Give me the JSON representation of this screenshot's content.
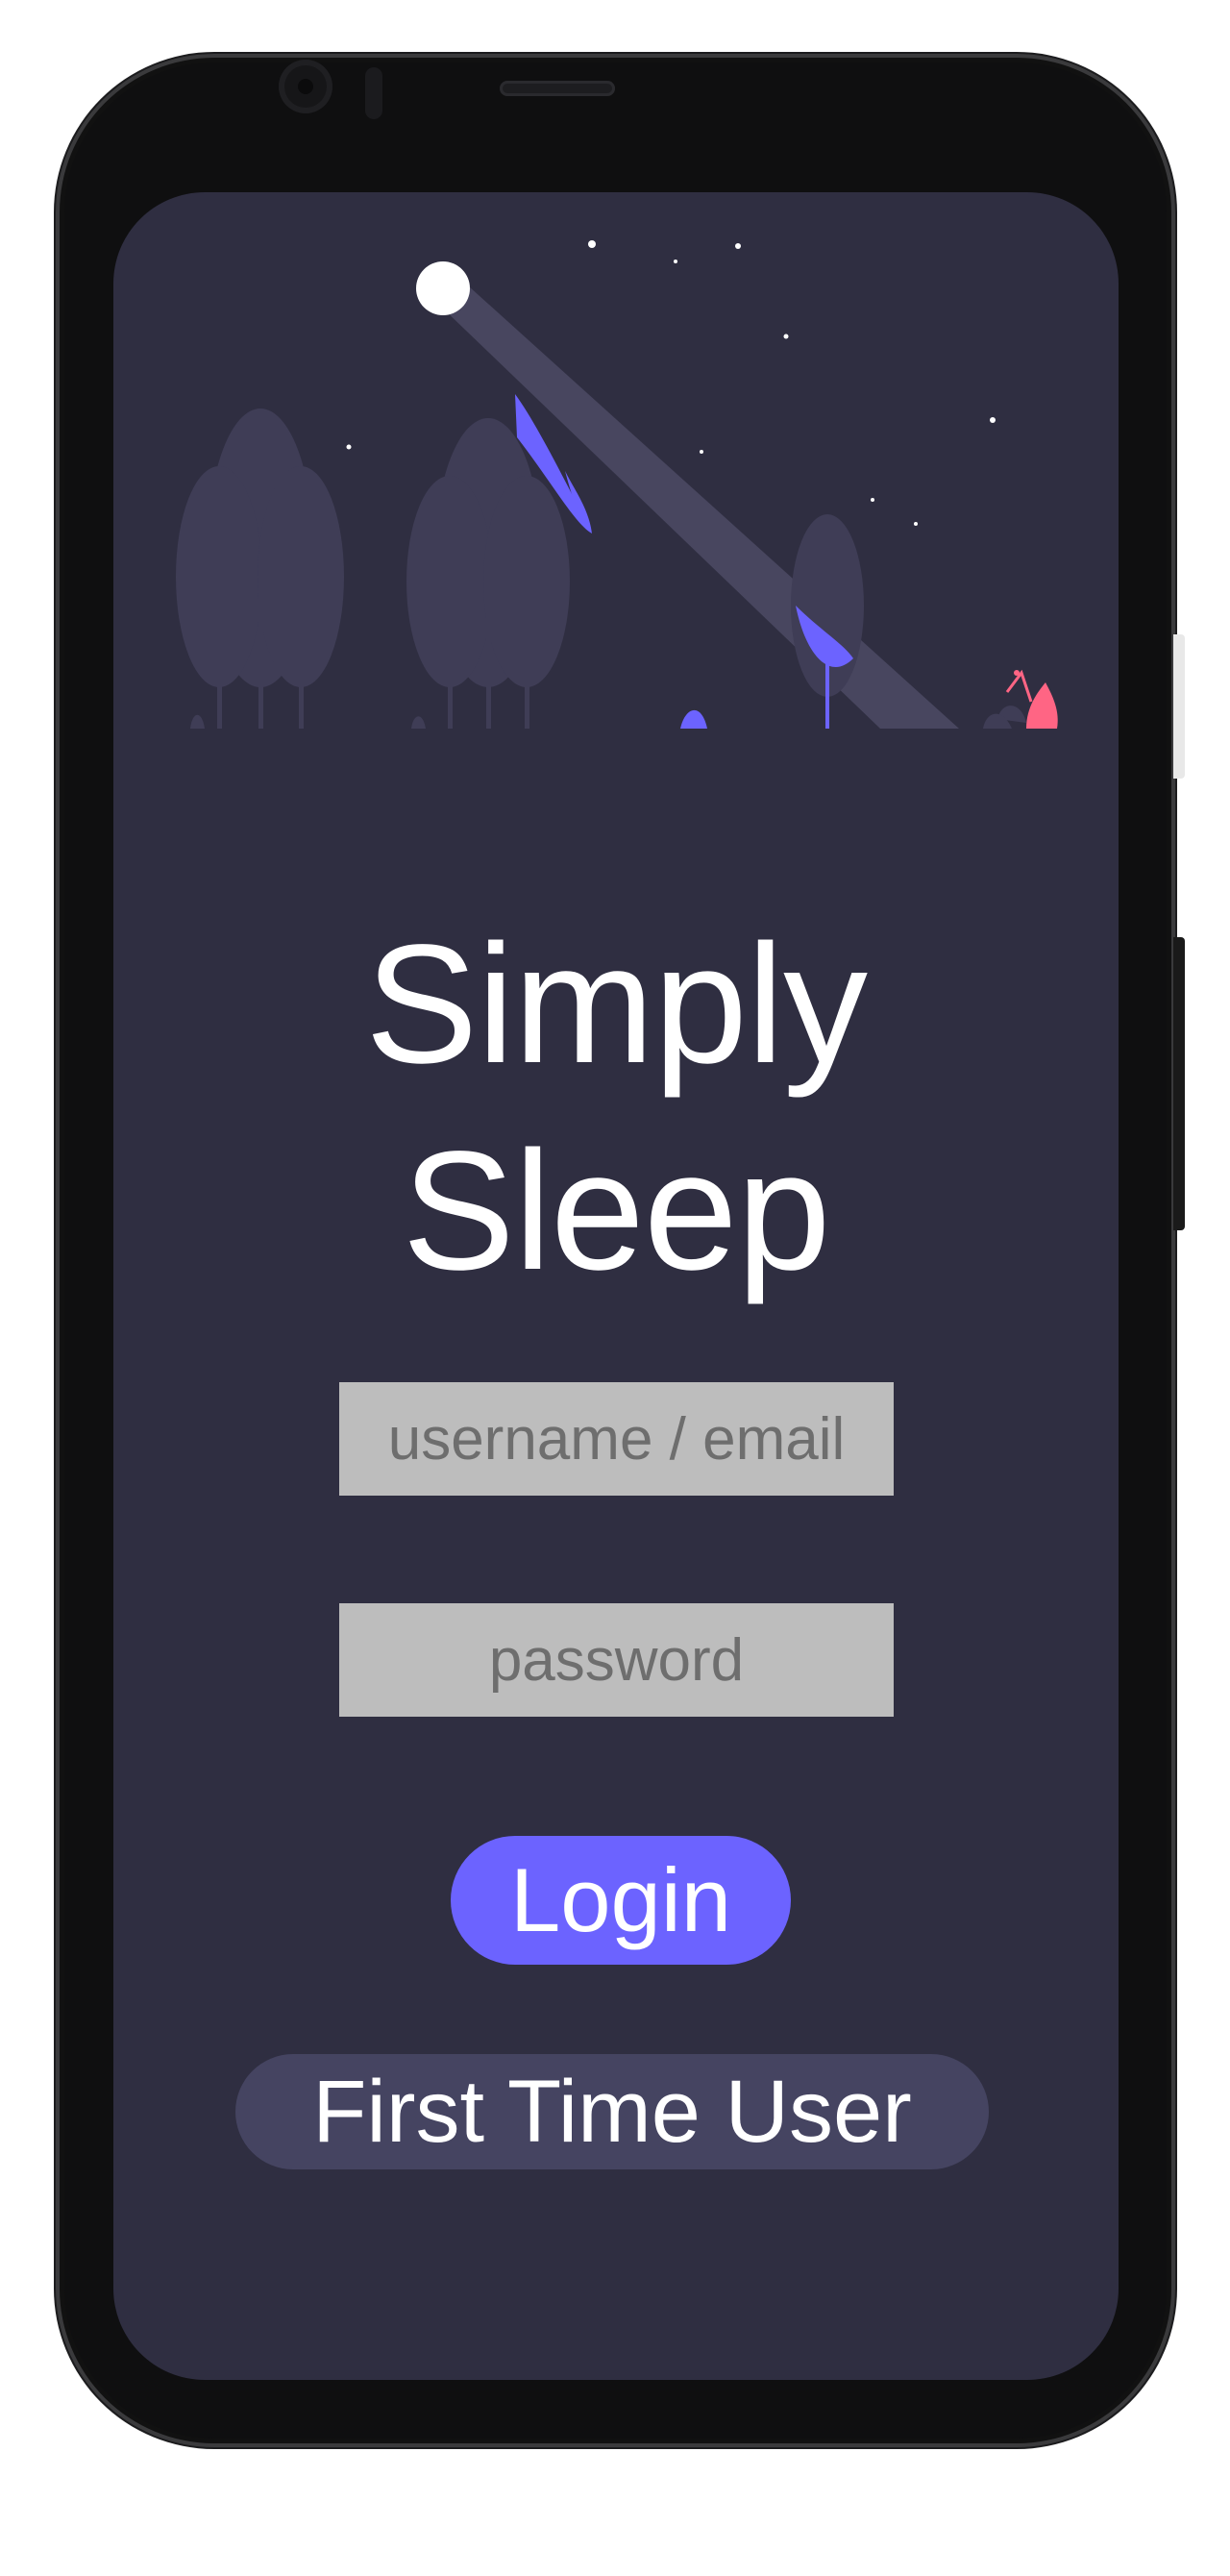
{
  "app": {
    "title_line1": "Simply",
    "title_line2": "Sleep"
  },
  "form": {
    "username_placeholder": "username / email",
    "username_value": "",
    "password_placeholder": "password",
    "password_value": "",
    "login_label": "Login",
    "first_time_label": "First Time User"
  },
  "colors": {
    "screen_bg": "#2f2e41",
    "accent": "#6c63ff",
    "secondary_button": "#454461",
    "input_bg": "#bdbdbd",
    "tree": "#3f3d56",
    "campfire": "#ff6584"
  },
  "illustration": {
    "name": "night-forest-moonlight",
    "icons": [
      "moon-icon",
      "tree-icon",
      "campfire-icon"
    ]
  }
}
